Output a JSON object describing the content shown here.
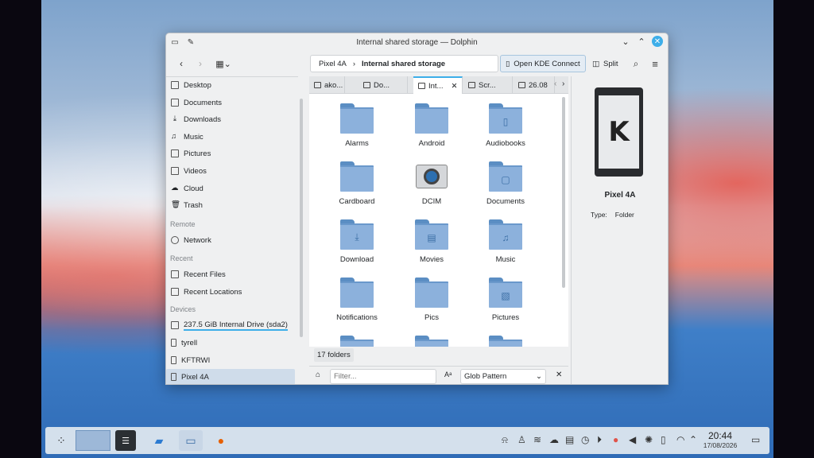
{
  "window": {
    "title": "Internal shared storage — Dolphin"
  },
  "toolbar": {
    "breadcrumb_parent": "Pixel 4A",
    "breadcrumb_current": "Internal shared storage",
    "kdeconnect_label": "Open KDE Connect",
    "split_label": "Split"
  },
  "sidebar": {
    "places": [
      "Desktop",
      "Documents",
      "Downloads",
      "Music",
      "Pictures",
      "Videos",
      "Cloud",
      "Trash"
    ],
    "remote_header": "Remote",
    "remote": [
      "Network"
    ],
    "recent_header": "Recent",
    "recent": [
      "Recent Files",
      "Recent Locations"
    ],
    "devices_header": "Devices",
    "devices": [
      "237.5 GiB Internal Drive (sda2)",
      "tyrell",
      "KFTRWI",
      "Pixel 4A"
    ]
  },
  "tabs": [
    "ako...",
    "Do...",
    "Int...",
    "Scr...",
    "26.08"
  ],
  "files": [
    "Alarms",
    "Android",
    "Audiobooks",
    "Cardboard",
    "DCIM",
    "Documents",
    "Download",
    "Movies",
    "Music",
    "Notifications",
    "Pics",
    "Pictures"
  ],
  "status": {
    "count": "17 folders",
    "filter_placeholder": "Filter...",
    "glob": "Glob Pattern"
  },
  "info": {
    "name": "Pixel 4A",
    "type_label": "Type:",
    "type_value": "Folder"
  },
  "taskbar": {
    "time": "20:44",
    "date": "17/08/2026"
  },
  "colors": {
    "accent": "#3daee9",
    "folder": "#8cb1dc",
    "selection": "#cfdcea"
  }
}
